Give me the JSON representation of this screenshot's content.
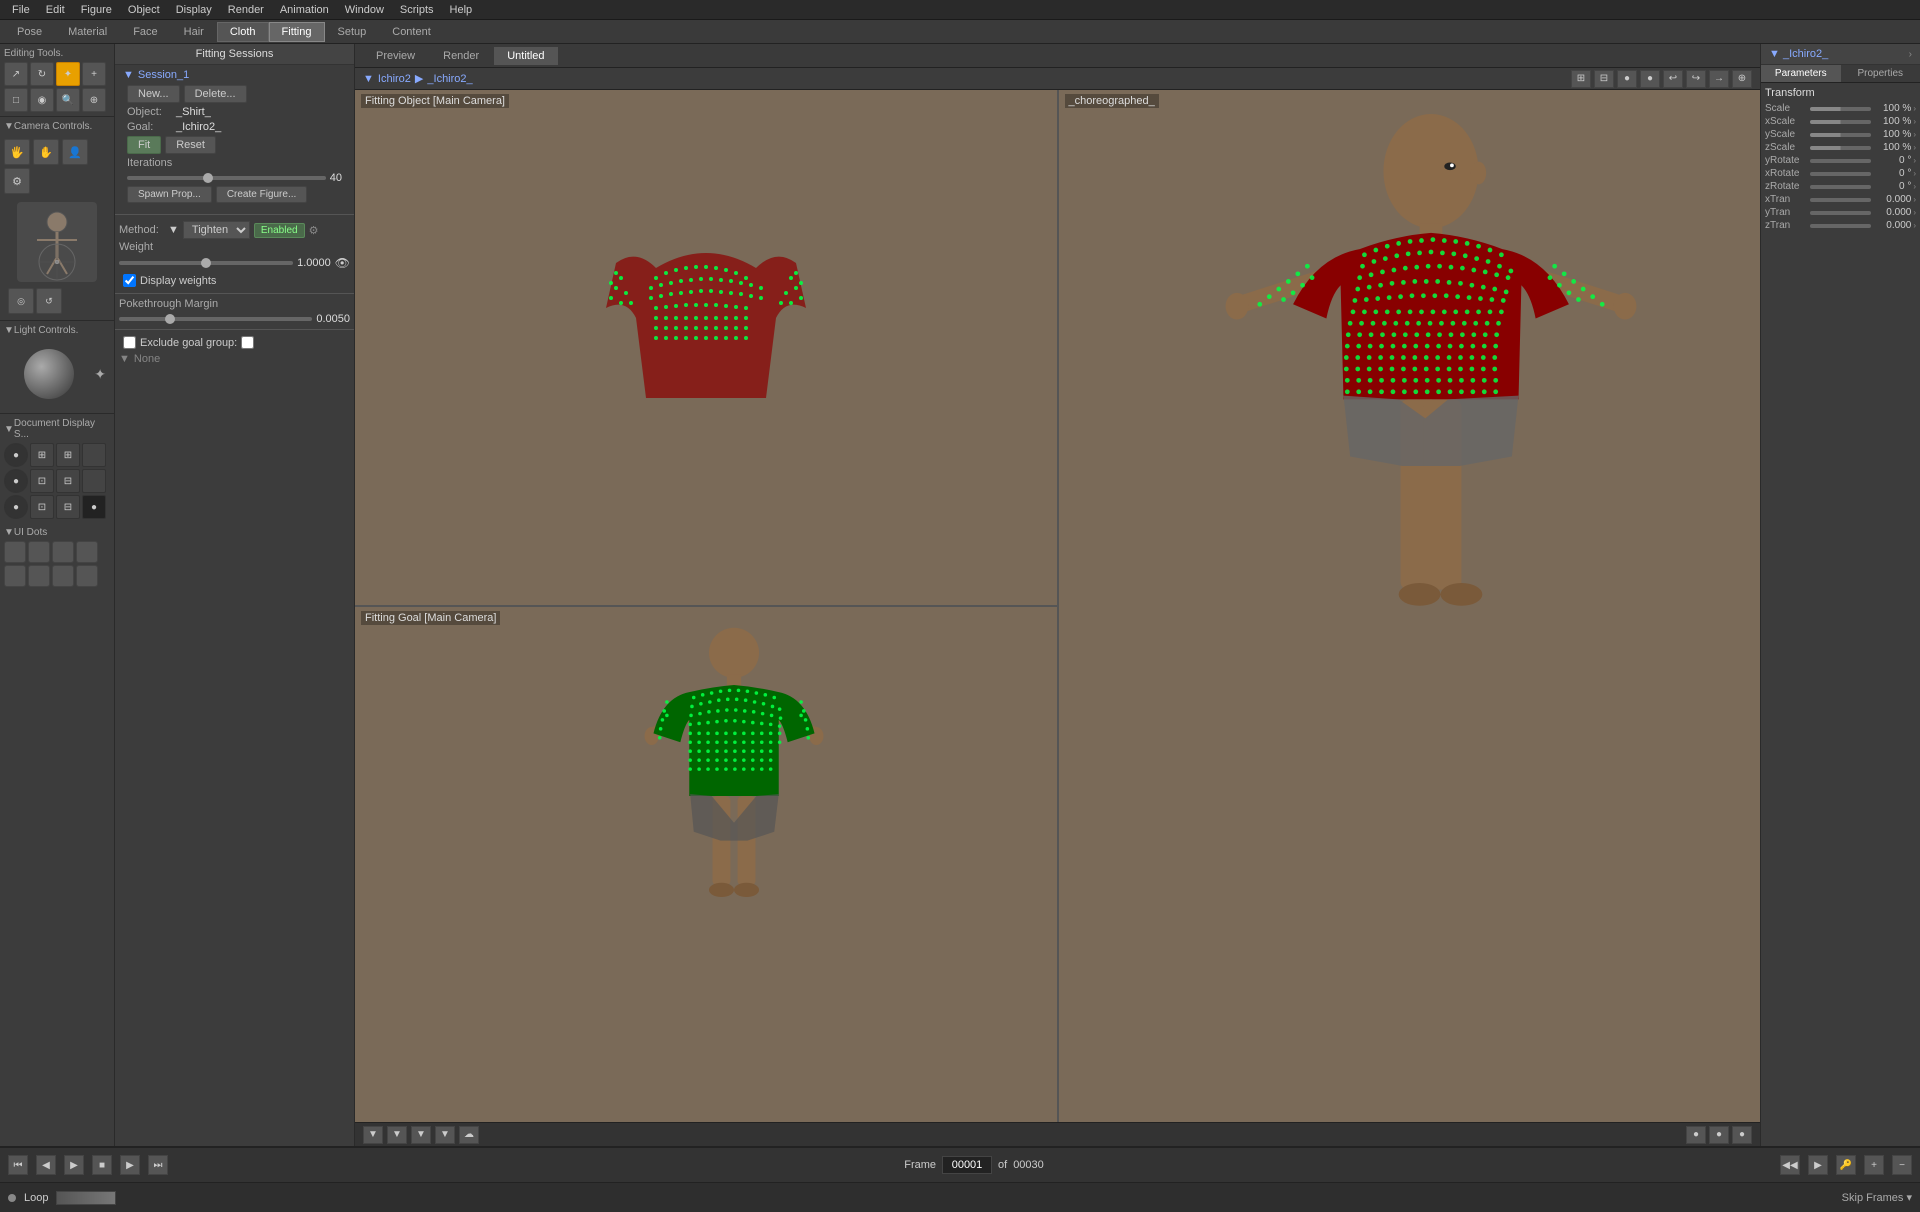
{
  "menubar": {
    "items": [
      "File",
      "Edit",
      "Figure",
      "Object",
      "Display",
      "Render",
      "Animation",
      "Window",
      "Scripts",
      "Help"
    ]
  },
  "toptabs": {
    "tabs": [
      "Pose",
      "Material",
      "Face",
      "Hair",
      "Cloth",
      "Fitting",
      "Setup",
      "Content"
    ]
  },
  "viewport": {
    "tabs": [
      "Preview",
      "Render",
      "Untitled"
    ],
    "active_tab": "Untitled",
    "breadcrumb1": "Ichiro2",
    "breadcrumb2": "_Ichiro2_",
    "vp_top_left_label": "Fitting Object [Main Camera]",
    "vp_bottom_left_label": "Fitting Goal [Main Camera]",
    "vp_right_label": "_choreographed_"
  },
  "fitting": {
    "panel_title": "Fitting Sessions",
    "session_name": "Session_1",
    "new_btn": "New...",
    "delete_btn": "Delete...",
    "object_label": "Object:",
    "object_value": "_Shirt_",
    "goal_label": "Goal:",
    "goal_value": "_Ichiro2_",
    "fit_btn": "Fit",
    "reset_btn": "Reset",
    "iterations_label": "Iterations",
    "iterations_value": "40",
    "spawn_prop_btn": "Spawn Prop...",
    "create_figure_btn": "Create Figure...",
    "method_label": "Method:",
    "method_value": "Tighten",
    "enabled_label": "Enabled",
    "weight_label": "Weight",
    "weight_value": "1.0000",
    "display_weights_label": "Display weights",
    "pokethru_label": "Pokethrough Margin",
    "pokethru_value": "0.0050",
    "exclude_goal_label": "Exclude goal group:",
    "none_label": "None"
  },
  "editing_tools": {
    "title": "Editing Tools."
  },
  "camera_controls": {
    "title": "Camera Controls."
  },
  "light_controls": {
    "title": "Light Controls."
  },
  "document_display": {
    "title": "Document Display S..."
  },
  "ui_dots": {
    "title": "UI Dots"
  },
  "right_panel": {
    "title": "_Ichiro2_",
    "tabs": [
      "Parameters",
      "Properties"
    ],
    "transform_label": "Transform",
    "scale_label": "Scale",
    "scale_value": "100 %",
    "xscale_label": "xScale",
    "xscale_value": "100 %",
    "yscale_label": "yScale",
    "yscale_value": "100 %",
    "zscale_label": "zScale",
    "zscale_value": "100 %",
    "yrotate_label": "yRotate",
    "yrotate_value": "0 °",
    "xrotate_label": "xRotate",
    "xrotate_value": "0 °",
    "zrotate_label": "zRotate",
    "zrotate_value": "0 °",
    "xtran_label": "xTran",
    "xtran_value": "0.000",
    "ytran_label": "yTran",
    "ytran_value": "0.000",
    "ztran_label": "zTran",
    "ztran_value": "0.000"
  },
  "timeline": {
    "frame_label": "Frame",
    "frame_current": "00001",
    "frame_of": "of",
    "frame_total": "00030",
    "loop_label": "Loop",
    "skip_frames_label": "Skip Frames ▾"
  },
  "icons": {
    "triangle_right": "▶",
    "triangle_left": "◀",
    "triangle_down": "▼",
    "square": "■",
    "chevron_right": "›",
    "chevron_left": "‹",
    "arrow_right": "→",
    "plus": "+",
    "minus": "−",
    "gear": "⚙",
    "eye": "👁",
    "key": "🔑",
    "camera": "📷"
  }
}
